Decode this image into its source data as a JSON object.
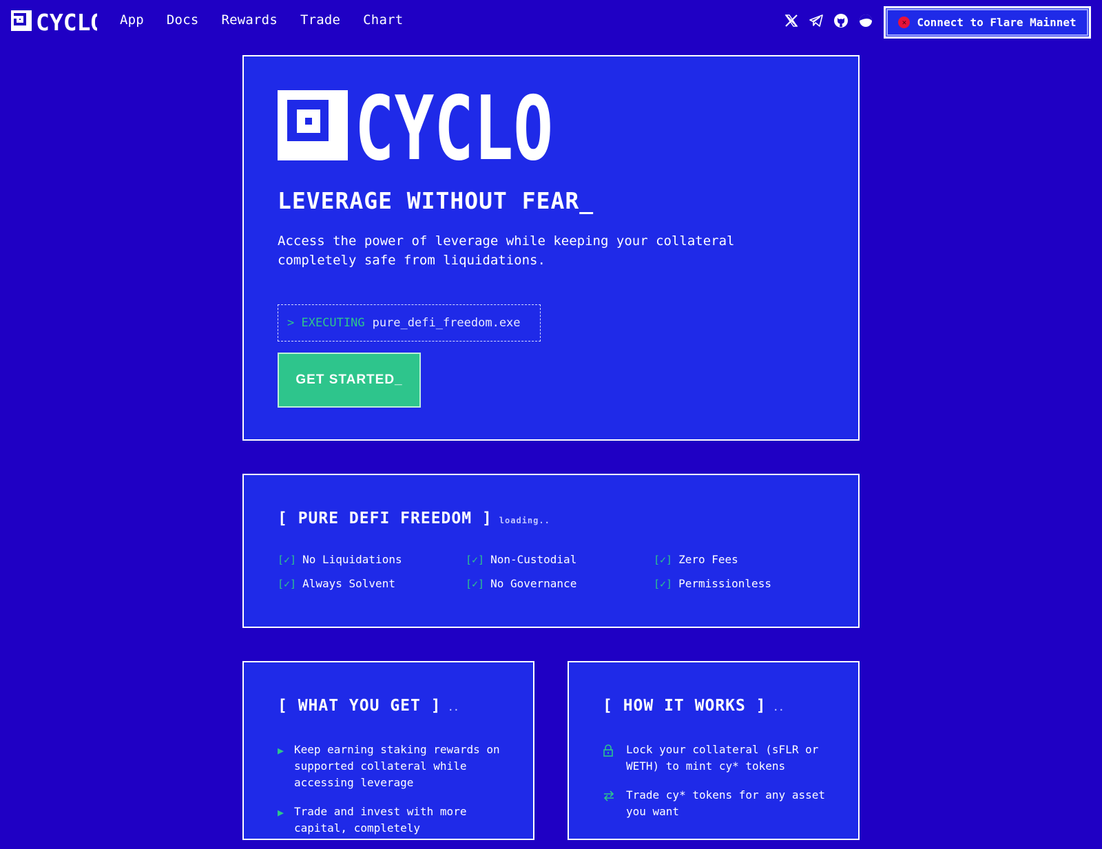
{
  "header": {
    "brand": "CYCLO",
    "nav": [
      "App",
      "Docs",
      "Rewards",
      "Trade",
      "Chart"
    ],
    "socials": [
      "x-icon",
      "telegram-icon",
      "github-icon",
      "theme-toggle-icon"
    ],
    "connect_label": "Connect to Flare Mainnet",
    "connect_status_icon": "close-icon",
    "status_color": "#e8133a"
  },
  "hero": {
    "logo_text": "CYCLO",
    "tagline": "LEVERAGE WITHOUT FEAR_",
    "subtitle": "Access the power of leverage while keeping your collateral completely safe from liquidations.",
    "exec_prefix": "> EXECUTING",
    "exec_command": "pure_defi_freedom.exe",
    "cta": "GET STARTED_"
  },
  "freedom": {
    "title": "[ PURE DEFI FREEDOM ]",
    "status": "loading..",
    "check_mark": "[✓]",
    "features": [
      "No Liquidations",
      "Non-Custodial",
      "Zero Fees",
      "Always Solvent",
      "No Governance",
      "Permissionless"
    ]
  },
  "what": {
    "title": "[ WHAT YOU GET ]",
    "status": "..",
    "items": [
      "Keep earning staking rewards on supported collateral while accessing leverage",
      "Trade and invest with more capital, completely"
    ]
  },
  "how": {
    "title": "[ HOW IT WORKS ]",
    "status": "..",
    "items": [
      {
        "icon": "lock-icon",
        "text": "Lock your collateral (sFLR or WETH) to mint cy* tokens"
      },
      {
        "icon": "swap-icon",
        "text": "Trade cy* tokens for any asset you want"
      }
    ]
  },
  "colors": {
    "background": "#1f00c4",
    "panel": "#1f2ae8",
    "accent": "#2ec58c"
  }
}
